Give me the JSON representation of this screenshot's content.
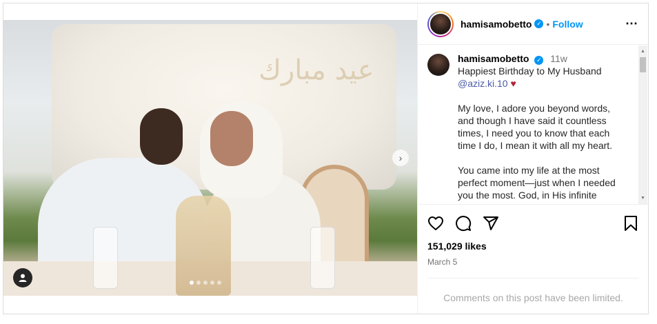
{
  "post": {
    "account": {
      "username": "hamisamobetto",
      "verified_mark": "✓",
      "separator": "•",
      "follow_label": "Follow",
      "more_icon": "⋯"
    },
    "media": {
      "arabic_text": "عيد مبارك",
      "next_icon": "›",
      "tagged_users_icon": "person-icon",
      "carousel_dots": 5,
      "active_dot": 0
    },
    "caption": {
      "username": "hamisamobetto",
      "time": "11w",
      "line1": "Happiest Birthday to My Husband",
      "mention": "@aziz.ki.10",
      "heart": "♥",
      "para1": "My love, I adore you beyond words, and though I have said it countless times, I need you to know that each time I do, I mean it with all my heart.",
      "para2": "You came into my life at the most perfect moment—just when I needed you the most. God, in His infinite"
    },
    "likes": "151,029 likes",
    "date": "March 5",
    "comments_limited": "Comments on this post have been limited.",
    "colors": {
      "link_blue": "#0095f6",
      "mention": "#4a5ba8",
      "heart": "#b0243a",
      "muted": "#737373"
    }
  }
}
